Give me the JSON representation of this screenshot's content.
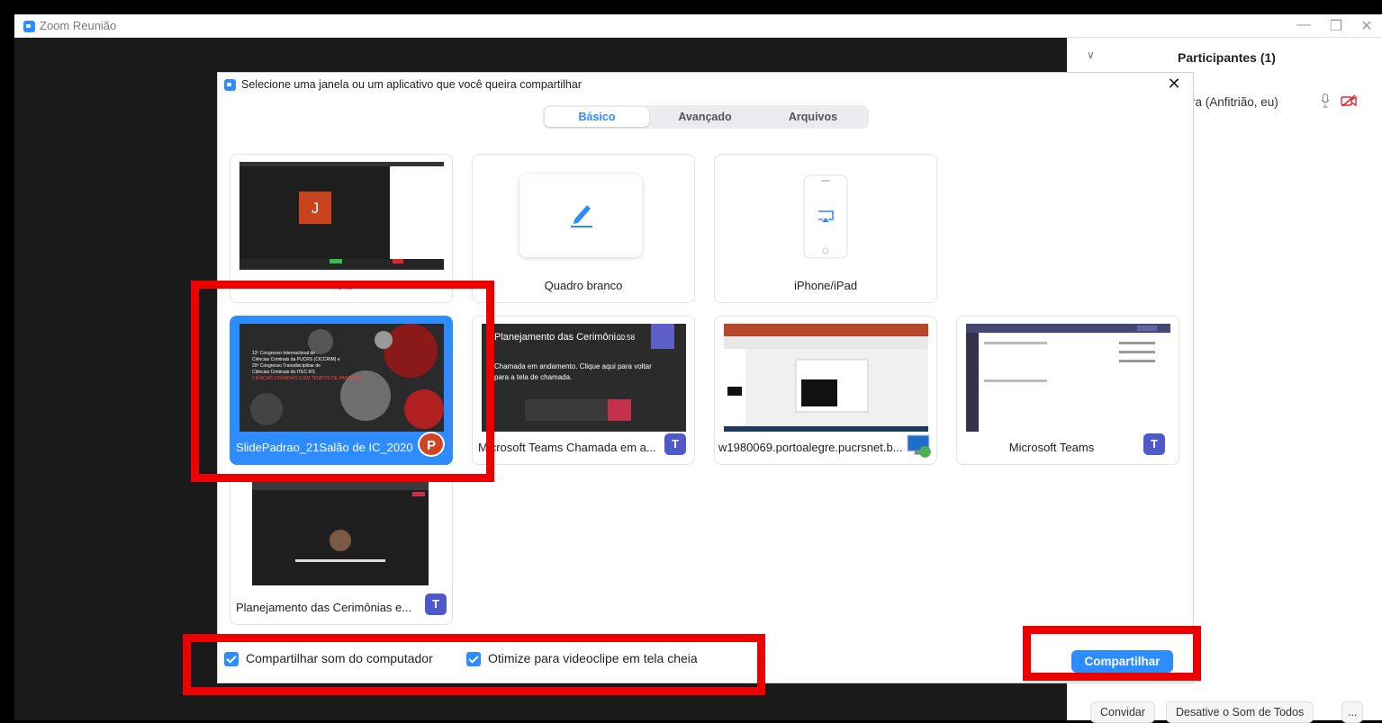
{
  "window": {
    "title": "Zoom Reunião",
    "minimize": "—",
    "restore": "❐",
    "close": "✕"
  },
  "participants_panel": {
    "collapse": "∨",
    "title": "Participantes (1)",
    "participant_name": "reira (Anfitrião, eu)",
    "invite_label": "Convidar",
    "mute_all_label": "Desative o Som de Todos",
    "more_label": "..."
  },
  "dialog": {
    "title": "Selecione uma janela ou um aplicativo que você queira compartilhar",
    "close": "✕",
    "tabs": [
      {
        "label": "Básico",
        "active": true
      },
      {
        "label": "Avançado",
        "active": false
      },
      {
        "label": "Arquivos",
        "active": false
      }
    ],
    "cards": {
      "tela": {
        "label": "Tela",
        "avatar_letter": "J"
      },
      "whiteboard": {
        "label": "Quadro branco"
      },
      "iphone": {
        "label": "iPhone/iPad"
      },
      "slide": {
        "label": "SlidePadrao_21Salão de IC_2020 (...",
        "thumb_lines": [
          "12º Congresso Internacional de",
          "Ciências Criminais da PUCRS (CICCRIM) e",
          "20º Congresso Transdisciplinar de",
          "Ciências Criminais do ITEC-RS",
          "CIÊNCIAS CRIMINAIS E EM TEMPOS DE PANDEMIA"
        ],
        "app_badge": "P"
      },
      "teams_call": {
        "label": "Microsoft Teams Chamada em a...",
        "call_title": "Planejamento das Cerimôni...",
        "call_time": "00:58",
        "call_msg": "Chamada em andamento. Clique aqui para voltar para a tela de chamada.",
        "app_badge": "T"
      },
      "remote": {
        "label": "w1980069.portoalegre.pucrsnet.b..."
      },
      "teams": {
        "label": "Microsoft Teams",
        "app_badge": "T"
      },
      "planning": {
        "label": "Planejamento das Cerimônias e...",
        "app_badge": "T"
      }
    },
    "share_audio_label": "Compartilhar som do computador",
    "optimize_video_label": "Otimize para videoclipe em tela cheia",
    "share_button": "Compartilhar"
  },
  "colors": {
    "accent": "#2d8cff",
    "highlight": "#ee0000",
    "powerpoint": "#d04423",
    "teams": "#5059c9"
  }
}
